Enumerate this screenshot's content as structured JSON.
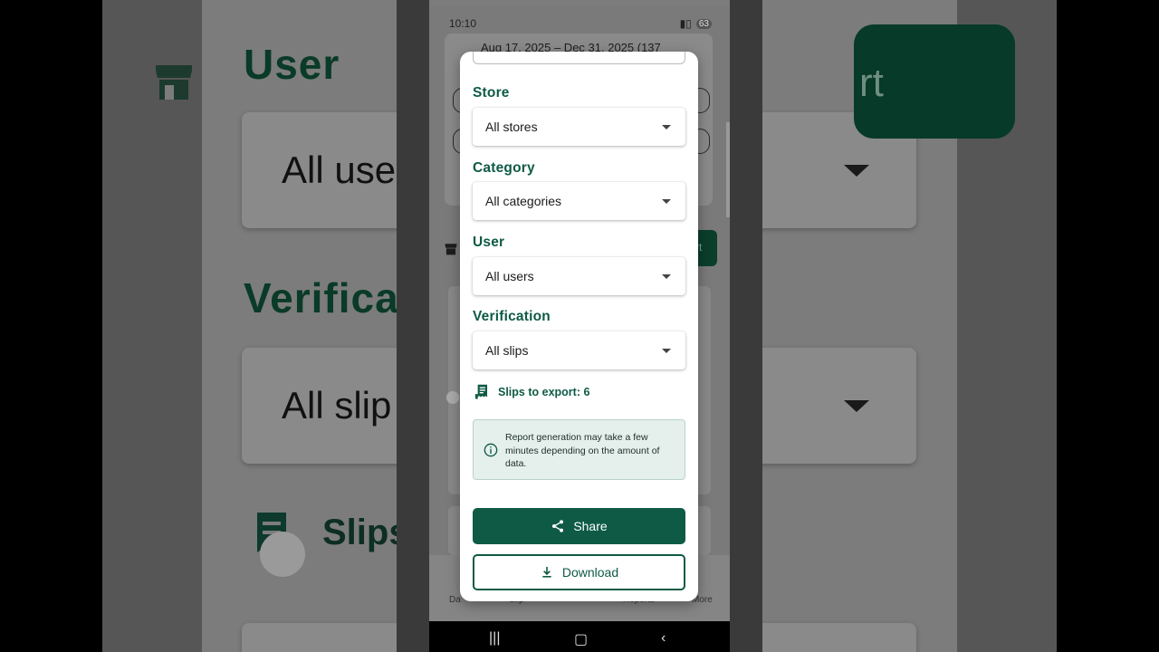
{
  "background": {
    "user_title": "User",
    "user_value": "All use",
    "verification_title": "Verifica",
    "verification_value": "All slip",
    "slips_label": "Slips",
    "export_btn_fragment": "rt"
  },
  "status_bar": {
    "time": "10:10",
    "battery": "63"
  },
  "underlying_screen": {
    "date_range": "Aug 17, 2025 – Dec 31, 2025  (137",
    "export_fragment": "rt",
    "nav": [
      "Da",
      "Slip",
      "Reports",
      "More"
    ]
  },
  "dialog": {
    "store": {
      "label": "Store",
      "value": "All stores"
    },
    "category": {
      "label": "Category",
      "value": "All categories"
    },
    "user": {
      "label": "User",
      "value": "All users"
    },
    "verification": {
      "label": "Verification",
      "value": "All slips"
    },
    "slips_to_export": "Slips to export: 6",
    "info_text": "Report generation may take a few minutes depending on the amount of data.",
    "share_label": "Share",
    "download_label": "Download"
  },
  "colors": {
    "primary": "#0e5a45",
    "info_bg": "#e5f0ec",
    "scrim": "#7a7a7a"
  },
  "icons": {
    "store": "store-icon",
    "slips": "receipt-icon",
    "info": "info-icon",
    "share": "share-icon",
    "download": "download-icon"
  }
}
